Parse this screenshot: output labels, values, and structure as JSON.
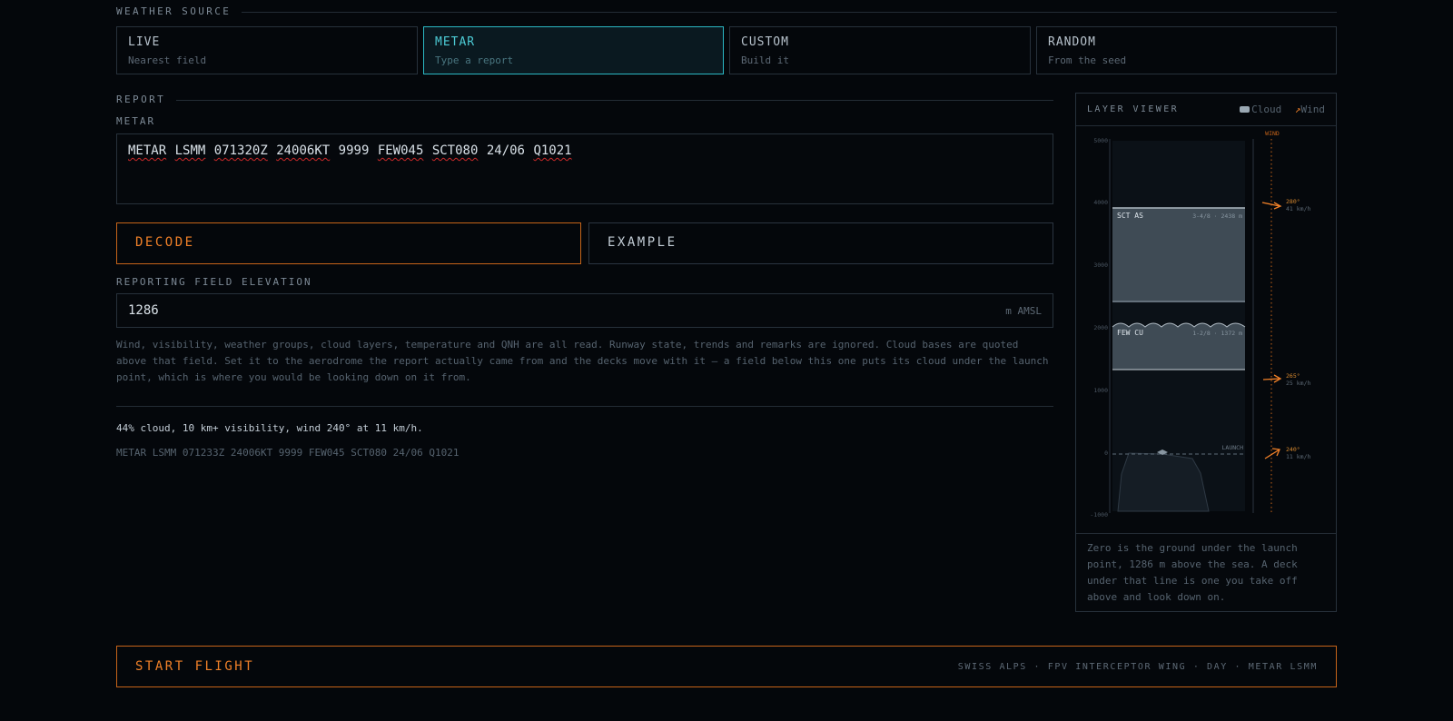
{
  "weather_source": {
    "title": "WEATHER SOURCE",
    "options": [
      {
        "label": "LIVE",
        "sub": "Nearest field",
        "active": false
      },
      {
        "label": "METAR",
        "sub": "Type a report",
        "active": true
      },
      {
        "label": "CUSTOM",
        "sub": "Build it",
        "active": false
      },
      {
        "label": "RANDOM",
        "sub": "From the seed",
        "active": false
      }
    ]
  },
  "report": {
    "title": "REPORT",
    "metar_label": "METAR",
    "metar_tokens": [
      "METAR",
      "LSMM",
      "071320Z",
      "24006KT",
      "9999",
      "FEW045",
      "SCT080",
      "24/06",
      "Q1021"
    ],
    "decode_label": "DECODE",
    "example_label": "EXAMPLE",
    "elevation_label": "REPORTING FIELD ELEVATION",
    "elevation_value": "1286",
    "elevation_unit": "m AMSL",
    "help_text": "Wind, visibility, weather groups, cloud layers, temperature and QNH are all read. Runway state, trends and remarks are ignored. Cloud bases are quoted above that field. Set it to the aerodrome the report actually came from and the decks move with it — a field below this one puts its cloud under the launch point, which is where you would be looking down on it from.",
    "summary": "44% cloud, 10 km+ visibility, wind 240° at 11 km/h.",
    "decoded_raw": "METAR LSMM 071233Z 24006KT 9999 FEW045 SCT080 24/06 Q1021"
  },
  "layer_viewer": {
    "title": "LAYER VIEWER",
    "legend_cloud": "Cloud",
    "legend_wind": "Wind",
    "wind_label": "WIND",
    "launch_label": "LAUNCH",
    "y_ticks": [
      "5000",
      "4000",
      "3000",
      "2000",
      "1000",
      "0",
      "-1000"
    ],
    "layers": [
      {
        "name": "SCT AS",
        "detail": "3-4/8 · 2438 m"
      },
      {
        "name": "FEW CU",
        "detail": "1-2/8 · 1372 m"
      }
    ],
    "winds": [
      {
        "dir": "280°",
        "speed": "41 km/h"
      },
      {
        "dir": "265°",
        "speed": "25 km/h"
      },
      {
        "dir": "240°",
        "speed": "11 km/h"
      }
    ],
    "note": "Zero is the ground under the launch point, 1286 m above the sea. A deck under that line is one you take off above and look down on.",
    "colors": {
      "cloud": "#6b7a86",
      "wind": "#f08028"
    }
  },
  "start": {
    "label": "START FLIGHT",
    "summary": "SWISS ALPS · FPV INTERCEPTOR WING · DAY · METAR LSMM"
  }
}
